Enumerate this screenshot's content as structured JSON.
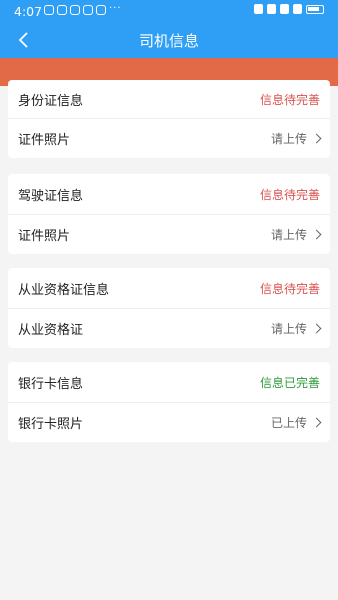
{
  "status_bar": {
    "time": "4:07",
    "more": "···"
  },
  "header": {
    "title": "司机信息"
  },
  "sections": [
    {
      "title": "身份证信息",
      "status": "信息待完善",
      "status_color": "#d9534f",
      "item": {
        "label": "证件照片",
        "action": "请上传"
      }
    },
    {
      "title": "驾驶证信息",
      "status": "信息待完善",
      "status_color": "#d9534f",
      "item": {
        "label": "证件照片",
        "action": "请上传"
      }
    },
    {
      "title": "从业资格证信息",
      "status": "信息待完善",
      "status_color": "#d9534f",
      "item": {
        "label": "从业资格证",
        "action": "请上传"
      }
    },
    {
      "title": "银行卡信息",
      "status": "信息已完善",
      "status_color": "#2f9a3a",
      "item": {
        "label": "银行卡照片",
        "action": "已上传"
      }
    }
  ],
  "colors": {
    "header": "#2f9ff5",
    "banner": "#e26a47",
    "background": "#f4f4f4"
  }
}
